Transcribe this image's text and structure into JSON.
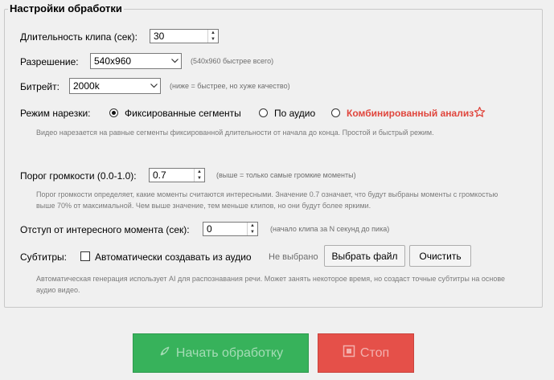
{
  "group_title": "Настройки обработки",
  "clip_duration": {
    "label": "Длительность клипа (сек):",
    "value": "30"
  },
  "resolution": {
    "label": "Разрешение:",
    "value": "540x960",
    "hint": "(540x960 быстрее всего)"
  },
  "bitrate": {
    "label": "Битрейт:",
    "value": "2000k",
    "hint": "(ниже = быстрее, но хуже качество)"
  },
  "cut_mode": {
    "label": "Режим нарезки:",
    "options": [
      "Фиксированные сегменты",
      "По аудио",
      "Комбинированный анализ"
    ],
    "selected": "Фиксированные сегменты",
    "description": "Видео нарезается на равные сегменты фиксированной длительности от начала до конца. Простой и быстрый режим."
  },
  "volume_threshold": {
    "label": "Порог громкости (0.0-1.0):",
    "value": "0.7",
    "hint": "(выше = только самые громкие моменты)",
    "description": "Порог громкости определяет, какие моменты считаются интересными. Значение 0.7 означает, что будут выбраны моменты с громкостью выше 70% от максимальной. Чем выше значение, тем меньше клипов, но они будут более яркими."
  },
  "offset": {
    "label": "Отступ от интересного момента (сек):",
    "value": "0",
    "hint": "(начало клипа за N секунд до пика)"
  },
  "subtitles": {
    "label": "Субтитры:",
    "checkbox_label": "Автоматически создавать из аудио",
    "checked": false,
    "file_status": "Не выбрано",
    "choose_button": "Выбрать файл",
    "clear_button": "Очистить",
    "description": "Автоматическая генерация использует AI для распознавания речи. Может занять некоторое время, но создаст точные субтитры на основе аудио видео."
  },
  "actions": {
    "start_label": "Начать обработку",
    "stop_label": "Стоп"
  },
  "colors": {
    "accent": "#e0463d",
    "start_bg": "#37b25b",
    "stop_bg": "#e55049"
  }
}
